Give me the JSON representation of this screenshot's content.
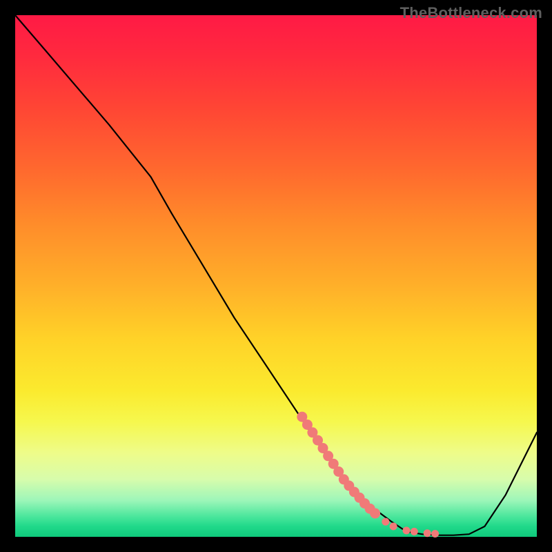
{
  "watermark": "TheBottleneck.com",
  "chart_data": {
    "type": "line",
    "title": "",
    "xlabel": "",
    "ylabel": "",
    "xlim": [
      0,
      100
    ],
    "ylim": [
      0,
      100
    ],
    "grid": false,
    "legend": false,
    "series": [
      {
        "name": "bottleneck-curve",
        "x": [
          0,
          6,
          12,
          18,
          22,
          26,
          30,
          36,
          42,
          48,
          54,
          60,
          64,
          68,
          72,
          75,
          78,
          81,
          84,
          87,
          90,
          94,
          100
        ],
        "y": [
          100,
          93,
          86,
          79,
          74,
          69,
          62,
          52,
          42,
          33,
          24,
          15,
          10,
          6,
          3,
          1,
          0.5,
          0.3,
          0.3,
          0.5,
          2,
          8,
          20
        ]
      }
    ],
    "dot_cluster": {
      "name": "highlight-dots",
      "color": "#f07a78",
      "points": [
        {
          "x": 55,
          "y": 23
        },
        {
          "x": 56,
          "y": 21.5
        },
        {
          "x": 57,
          "y": 20
        },
        {
          "x": 58,
          "y": 18.5
        },
        {
          "x": 59,
          "y": 17
        },
        {
          "x": 60,
          "y": 15.5
        },
        {
          "x": 61,
          "y": 14
        },
        {
          "x": 62,
          "y": 12.5
        },
        {
          "x": 63,
          "y": 11
        },
        {
          "x": 64,
          "y": 9.8
        },
        {
          "x": 65,
          "y": 8.6
        },
        {
          "x": 66,
          "y": 7.5
        },
        {
          "x": 67,
          "y": 6.4
        },
        {
          "x": 68,
          "y": 5.4
        },
        {
          "x": 69,
          "y": 4.5
        },
        {
          "x": 71,
          "y": 2.9
        },
        {
          "x": 72.5,
          "y": 2.0
        },
        {
          "x": 75,
          "y": 1.2
        },
        {
          "x": 76.5,
          "y": 1.0
        },
        {
          "x": 79,
          "y": 0.7
        },
        {
          "x": 80.5,
          "y": 0.6
        }
      ]
    },
    "gradient_stops": [
      {
        "pos": 0.0,
        "color": "#ff1a45"
      },
      {
        "pos": 0.3,
        "color": "#ff6a2e"
      },
      {
        "pos": 0.62,
        "color": "#ffd228"
      },
      {
        "pos": 0.85,
        "color": "#d7fcac"
      },
      {
        "pos": 1.0,
        "color": "#0fc97c"
      }
    ]
  }
}
